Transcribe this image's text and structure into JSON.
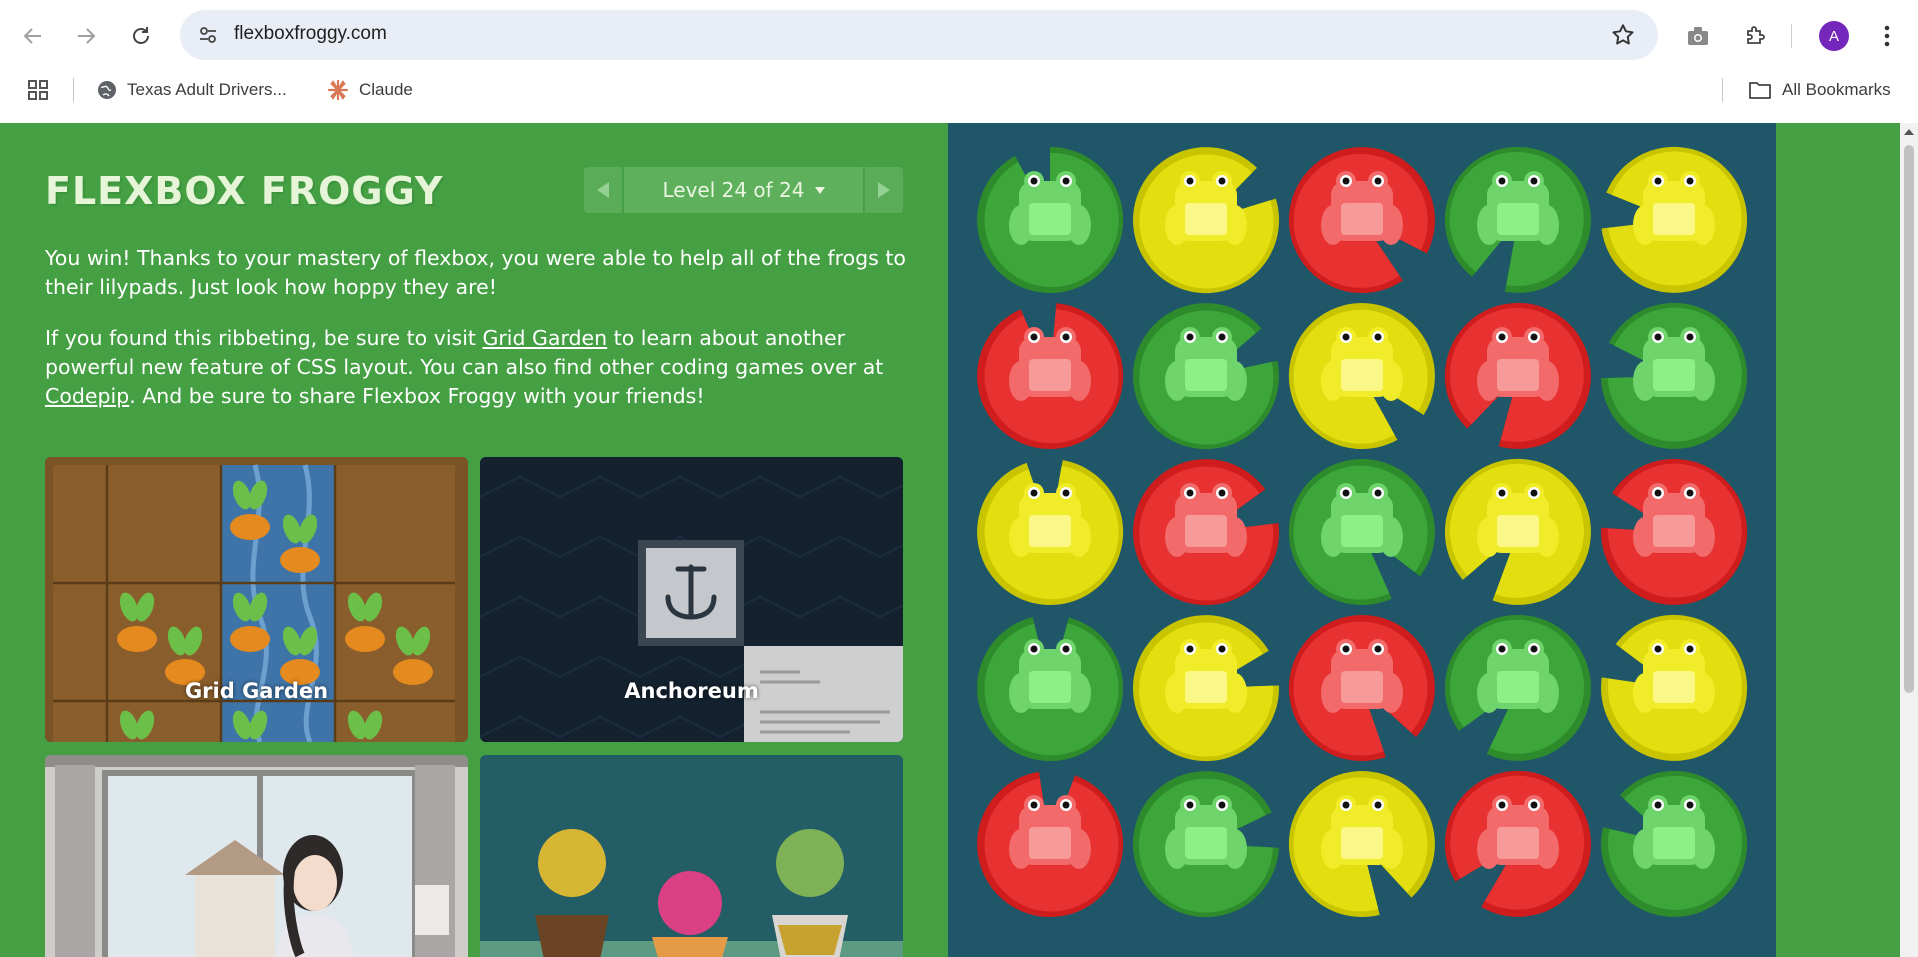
{
  "browser": {
    "url": "flexboxfroggy.com",
    "bookmarks": [
      {
        "label": "Texas Adult Drivers..."
      },
      {
        "label": "Claude"
      }
    ],
    "all_bookmarks_label": "All Bookmarks",
    "avatar_letter": "A"
  },
  "game": {
    "logo": "FLEXBOX FROGGY",
    "level_label": "Level 24 of 24",
    "win_text": "You win! Thanks to your mastery of flexbox, you were able to help all of the frogs to their lilypads. Just look how hoppy they are!",
    "share": {
      "part1": "If you found this ribbeting, be sure to visit ",
      "link1": "Grid Garden",
      "part2": " to learn about another powerful new feature of CSS layout. You can also find other coding games over at ",
      "link2": "Codepip",
      "part3": ". And be sure to share Flexbox Froggy with your friends!"
    },
    "cards": [
      {
        "label": "Grid Garden"
      },
      {
        "label": "Anchoreum"
      },
      {
        "label": ""
      },
      {
        "label": ""
      }
    ],
    "board": {
      "rows": [
        [
          "green",
          "yellow",
          "red",
          "green",
          "yellow"
        ],
        [
          "red",
          "green",
          "yellow",
          "red",
          "green"
        ],
        [
          "yellow",
          "red",
          "green",
          "yellow",
          "red"
        ],
        [
          "green",
          "yellow",
          "red",
          "green",
          "yellow"
        ],
        [
          "red",
          "green",
          "yellow",
          "red",
          "green"
        ]
      ],
      "colors": {
        "green": {
          "pad": "#2e8b2c",
          "pad_light": "#3da63b",
          "body": "#6fd46b",
          "belly": "#8cf088"
        },
        "yellow": {
          "pad": "#c8c400",
          "pad_light": "#e2de10",
          "body": "#f0ec2a",
          "belly": "#fbf888"
        },
        "red": {
          "pad": "#cf1c1c",
          "pad_light": "#e83131",
          "body": "#f26a6a",
          "belly": "#f79a9a"
        }
      }
    }
  },
  "colors": {
    "page_bg": "#44a043",
    "board_bg": "#1f5768"
  }
}
